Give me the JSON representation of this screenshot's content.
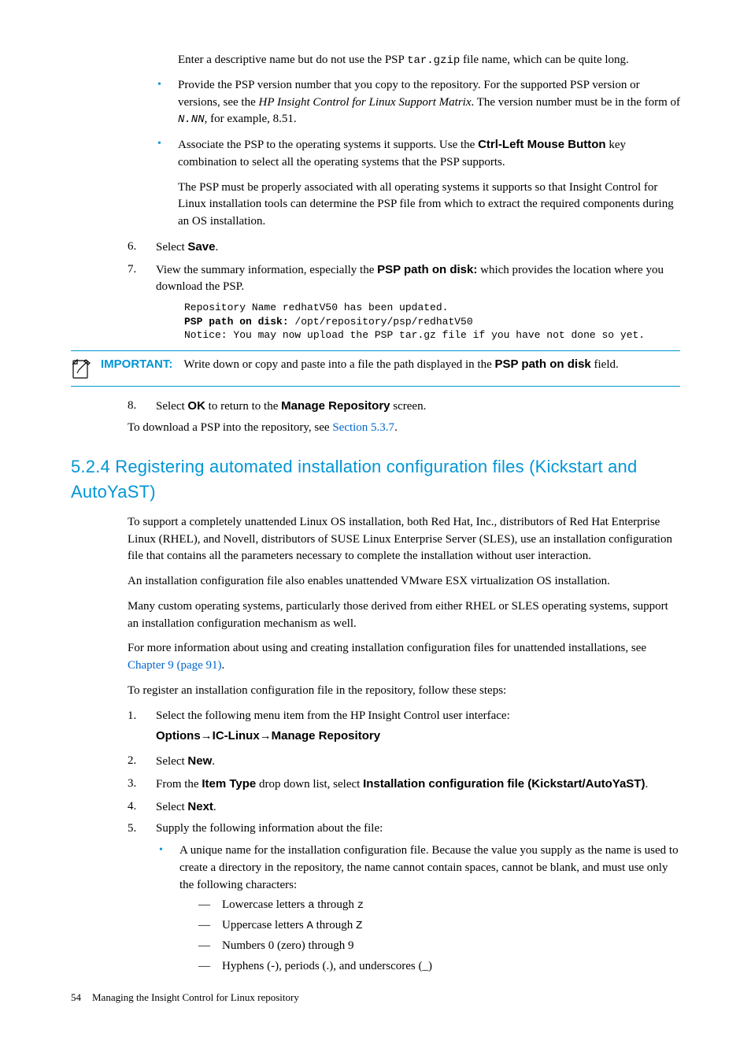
{
  "intro": {
    "p1_a": "Enter a descriptive name but do not use the PSP ",
    "p1_code": "tar.gzip",
    "p1_b": " file name, which can be quite long."
  },
  "bullets": {
    "b1_a": "Provide the PSP version number that you copy to the repository. For the supported PSP version or versions, see the ",
    "b1_i": "HP Insight Control for Linux Support Matrix",
    "b1_b": ". The version number must be in the form of ",
    "b1_code": "N.NN",
    "b1_c": ", for example, 8.51.",
    "b2_a": "Associate the PSP to the operating systems it supports. Use the ",
    "b2_bold": "Ctrl-Left Mouse Button",
    "b2_b": " key combination to select all the operating systems that the PSP supports.",
    "b2_p2": "The PSP must be properly associated with all operating systems it supports so that Insight Control for Linux installation tools can determine the PSP file from which to extract the required components during an OS installation."
  },
  "steps_a": {
    "s6_num": "6.",
    "s6_a": "Select ",
    "s6_bold": "Save",
    "s6_b": ".",
    "s7_num": "7.",
    "s7_a": "View the summary information, especially the ",
    "s7_bold": "PSP path on disk:",
    "s7_b": " which provides the location where you download the PSP."
  },
  "code": {
    "l1": "Repository Name redhatV50 has been updated.",
    "l2a": "PSP path on disk:",
    "l2b": " /opt/repository/psp/redhatV50",
    "l3": "Notice: You may now upload the PSP tar.gz file if you have not done so yet."
  },
  "important": {
    "label": "IMPORTANT:",
    "text_a": "Write down or copy and paste into a file the path displayed in the ",
    "text_bold": "PSP path on disk",
    "text_b": " field."
  },
  "steps_b": {
    "s8_num": "8.",
    "s8_a": "Select ",
    "s8_bold1": "OK",
    "s8_b": " to return to the ",
    "s8_bold2": "Manage Repository",
    "s8_c": " screen."
  },
  "after_steps": {
    "p_a": "To download a PSP into the repository, see ",
    "p_link": "Section 5.3.7",
    "p_b": "."
  },
  "heading": "5.2.4 Registering automated installation configuration files (Kickstart and AutoYaST)",
  "section": {
    "p1": "To support a completely unattended Linux OS installation, both Red Hat, Inc., distributors of Red Hat Enterprise Linux (RHEL), and Novell, distributors of SUSE Linux Enterprise Server (SLES), use an installation configuration file that contains all the parameters necessary to complete the installation without user interaction.",
    "p2": "An installation configuration file also enables unattended VMware ESX virtualization OS installation.",
    "p3": "Many custom operating systems, particularly those derived from either RHEL or SLES operating systems, support an installation configuration mechanism as well.",
    "p4_a": "For more information about using and creating installation configuration files for unattended installations, see ",
    "p4_link": "Chapter 9 (page 91)",
    "p4_b": ".",
    "p5": "To register an installation configuration file in the repository, follow these steps:"
  },
  "steps_c": {
    "s1_num": "1.",
    "s1": "Select the following menu item from the HP Insight Control user interface:",
    "menu_a": "Options",
    "menu_b": "IC-Linux",
    "menu_c": "Manage Repository",
    "s2_num": "2.",
    "s2_a": "Select ",
    "s2_bold": "New",
    "s2_b": ".",
    "s3_num": "3.",
    "s3_a": "From the ",
    "s3_bold1": "Item Type",
    "s3_b": " drop down list, select ",
    "s3_bold2": "Installation configuration file (Kickstart/AutoYaST)",
    "s3_c": ".",
    "s4_num": "4.",
    "s4_a": "Select ",
    "s4_bold": "Next",
    "s4_b": ".",
    "s5_num": "5.",
    "s5": "Supply the following information about the file:",
    "s5_b1": "A unique name for the installation configuration file. Because the value you supply as the name is used to create a directory in the repository, the name cannot contain spaces, cannot be blank, and must use only the following characters:"
  },
  "dashes": {
    "d1_a": "Lowercase letters ",
    "d1_c1": "a",
    "d1_b": " through ",
    "d1_c2": "z",
    "d2_a": "Uppercase letters ",
    "d2_c1": "A",
    "d2_b": " through ",
    "d2_c2": "Z",
    "d3": "Numbers 0 (zero) through 9",
    "d4": "Hyphens (-), periods (.), and underscores (_)"
  },
  "footer": {
    "page": "54",
    "title": "Managing the Insight Control for Linux repository"
  }
}
